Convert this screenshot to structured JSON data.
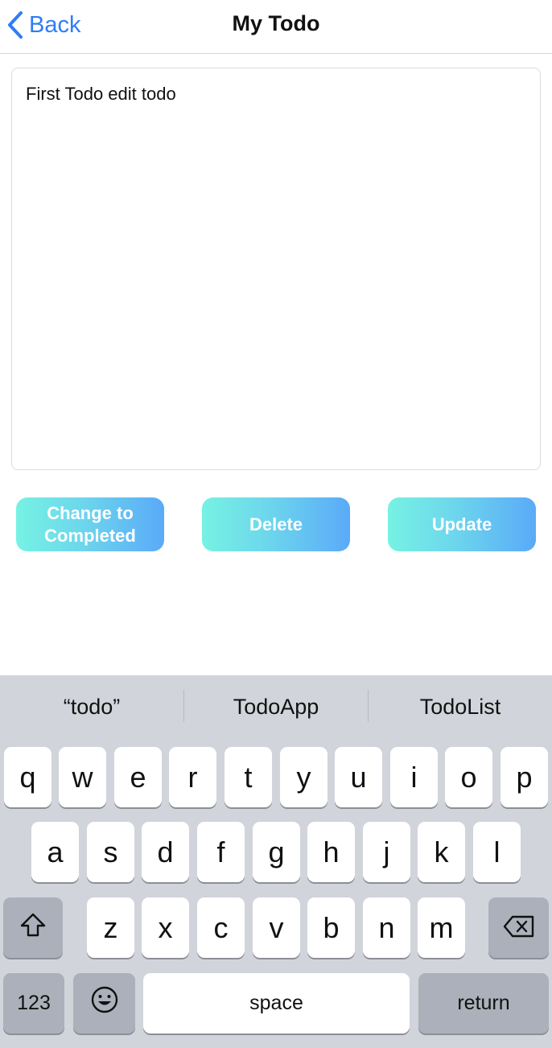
{
  "nav": {
    "back_label": "Back",
    "title": "My Todo"
  },
  "editor": {
    "value": "First Todo edit todo"
  },
  "actions": {
    "change_label_line1": "Change to",
    "change_label_line2": "Completed",
    "delete_label": "Delete",
    "update_label": "Update"
  },
  "keyboard": {
    "suggestions": [
      "“todo”",
      "TodoApp",
      "TodoList"
    ],
    "row1": [
      "q",
      "w",
      "e",
      "r",
      "t",
      "y",
      "u",
      "i",
      "o",
      "p"
    ],
    "row2": [
      "a",
      "s",
      "d",
      "f",
      "g",
      "h",
      "j",
      "k",
      "l"
    ],
    "row3": [
      "z",
      "x",
      "c",
      "v",
      "b",
      "n",
      "m"
    ],
    "numbers_label": "123",
    "space_label": "space",
    "return_label": "return"
  },
  "colors": {
    "accent": "#2f7df6",
    "button_gradient_start": "#76f2e3",
    "button_gradient_end": "#5aaaf8",
    "keyboard_bg": "#d1d4da"
  },
  "icons": {
    "back": "chevron-left-icon",
    "shift": "shift-arrow-icon",
    "delete": "backspace-icon",
    "emoji": "smiley-face-icon"
  }
}
